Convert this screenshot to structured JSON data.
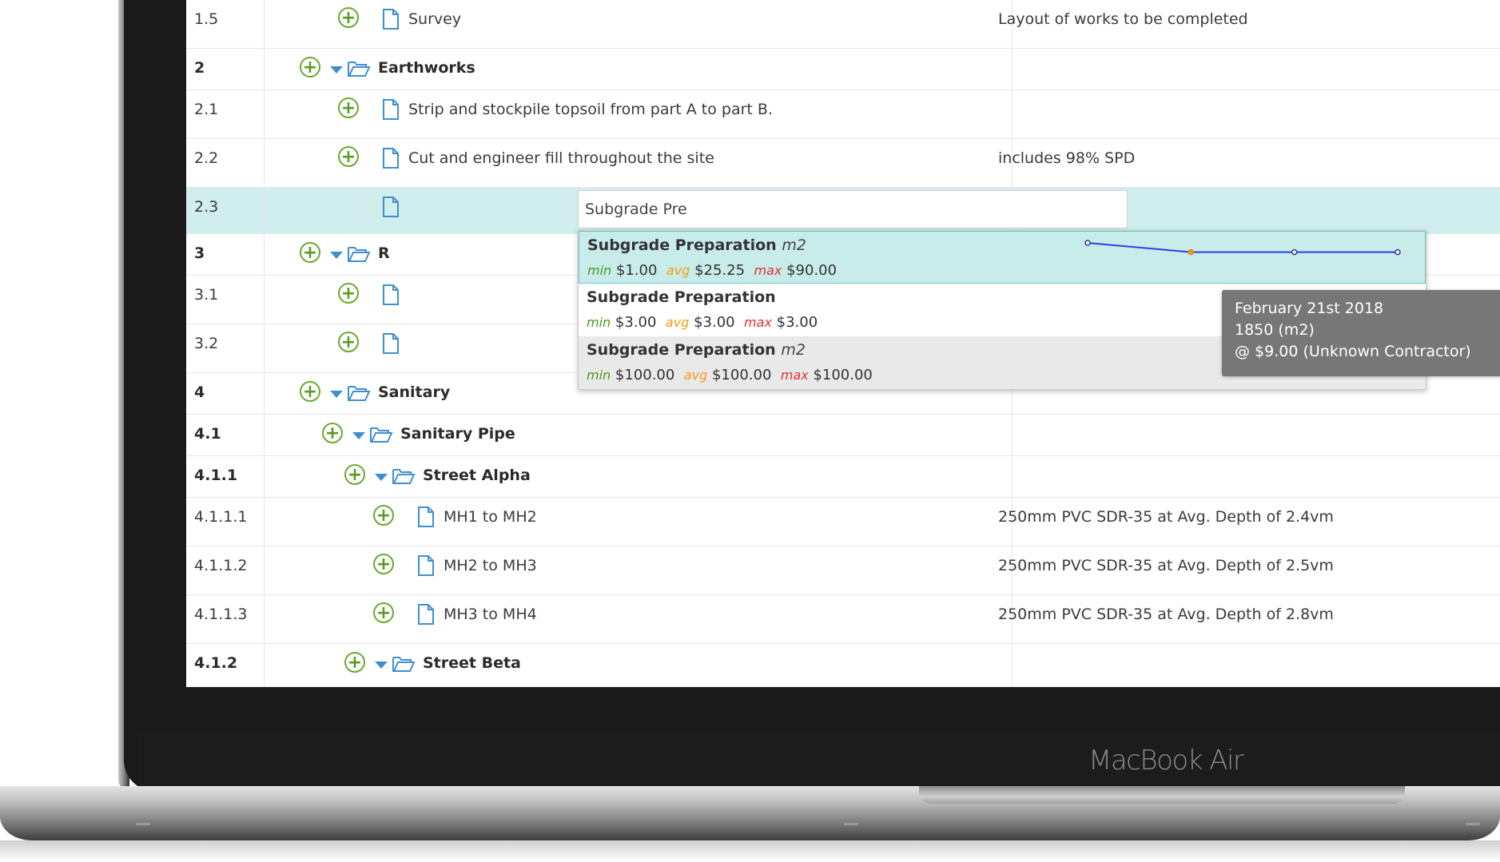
{
  "rows": [
    {
      "num": "1.5",
      "label": "Survey",
      "note": "Layout of works to be completed"
    },
    {
      "num": "2",
      "label": "Earthworks",
      "note": ""
    },
    {
      "num": "2.1",
      "label": "Strip and stockpile topsoil from part A to part B.",
      "note": ""
    },
    {
      "num": "2.2",
      "label": "Cut and engineer fill throughout the site",
      "note": "includes 98% SPD"
    },
    {
      "num": "2.3",
      "label": "",
      "note": ""
    },
    {
      "num": "3",
      "label": "R",
      "note": ""
    },
    {
      "num": "3.1",
      "label": "",
      "note": ""
    },
    {
      "num": "3.2",
      "label": "",
      "note": ""
    },
    {
      "num": "4",
      "label": "Sanitary",
      "note": ""
    },
    {
      "num": "4.1",
      "label": "Sanitary Pipe",
      "note": ""
    },
    {
      "num": "4.1.1",
      "label": "Street Alpha",
      "note": ""
    },
    {
      "num": "4.1.1.1",
      "label": "MH1 to MH2",
      "note": "250mm PVC SDR-35 at Avg. Depth of 2.4vm"
    },
    {
      "num": "4.1.1.2",
      "label": "MH2 to MH3",
      "note": "250mm PVC SDR-35 at Avg. Depth of 2.5vm"
    },
    {
      "num": "4.1.1.3",
      "label": "MH3 to MH4",
      "note": "250mm PVC SDR-35 at Avg. Depth of 2.8vm"
    },
    {
      "num": "4.1.2",
      "label": "Street Beta",
      "note": ""
    }
  ],
  "editor": {
    "value": "Subgrade Pre"
  },
  "suggestions": [
    {
      "name": "Subgrade Preparation",
      "unit": "m2",
      "min_key": "min",
      "min": "$1.00",
      "avg_key": "avg",
      "avg": "$25.25",
      "max_key": "max",
      "max": "$90.00"
    },
    {
      "name": "Subgrade Preparation",
      "unit": "",
      "min_key": "min",
      "min": "$3.00",
      "avg_key": "avg",
      "avg": "$3.00",
      "max_key": "max",
      "max": "$3.00"
    },
    {
      "name": "Subgrade Preparation",
      "unit": "m2",
      "min_key": "min",
      "min": "$100.00",
      "avg_key": "avg",
      "avg": "$100.00",
      "max_key": "max",
      "max": "$100.00"
    }
  ],
  "sparkline": {
    "type": "line",
    "values": [
      9.0,
      4.0,
      4.0,
      4.0
    ],
    "highlight_index": 1
  },
  "tooltip": {
    "line1": "February 21st 2018",
    "line2": "1850 (m2)",
    "line3": "@ $9.00 (Unknown Contractor)"
  },
  "laptop": {
    "label": "MacBook Air"
  },
  "colors": {
    "highlight_row": "#cfeeed",
    "plus": "#6aaa2e",
    "folder": "#3f8fd0",
    "sparkline": "#2b3ee6"
  },
  "icons": {
    "add": "plus-circle-icon",
    "folder": "folder-open-icon",
    "document": "document-icon",
    "expand": "caret-down-icon"
  }
}
